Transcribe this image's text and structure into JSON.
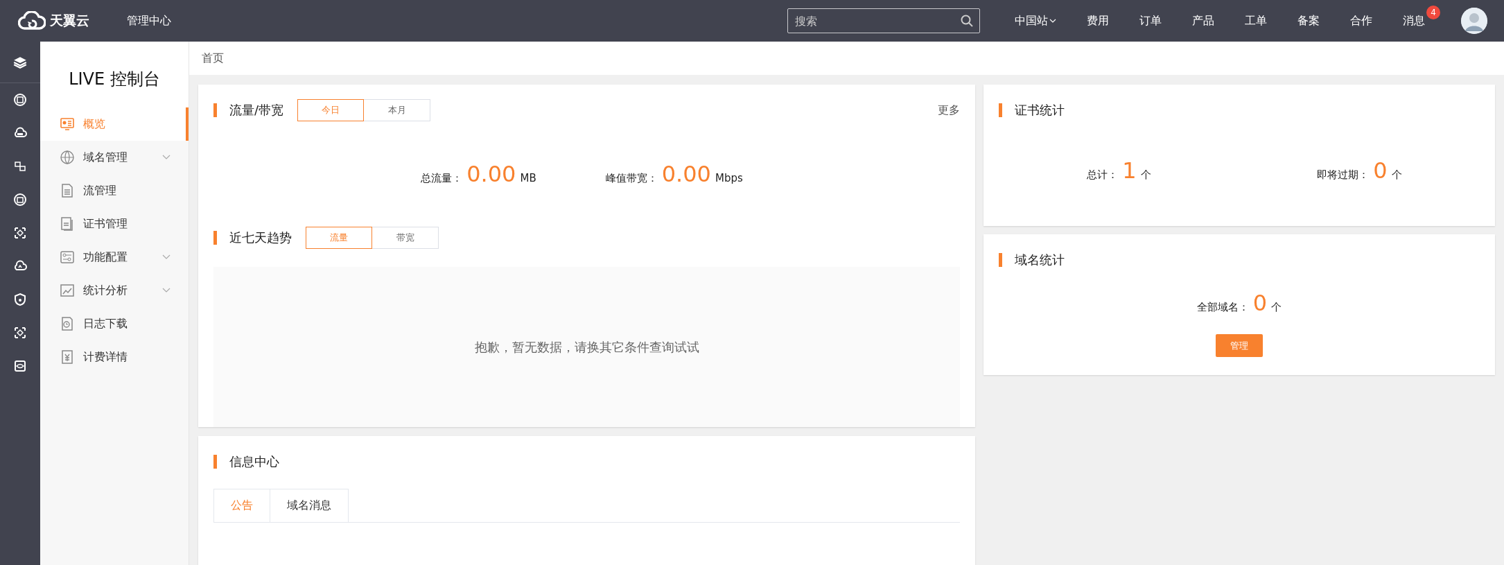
{
  "topbar": {
    "brand": "天翼云",
    "center": "管理中心",
    "search": {
      "placeholder": "搜索"
    },
    "nav": [
      {
        "label": "中国站",
        "dropdown": true
      },
      {
        "label": "费用",
        "dropdown": false
      },
      {
        "label": "订单",
        "dropdown": false
      },
      {
        "label": "产品",
        "dropdown": false
      },
      {
        "label": "工单",
        "dropdown": false
      },
      {
        "label": "备案",
        "dropdown": false
      },
      {
        "label": "合作",
        "dropdown": false
      },
      {
        "label": "消息",
        "dropdown": false,
        "badge": "4"
      }
    ]
  },
  "sidebar": {
    "title": "LIVE 控制台",
    "items": [
      {
        "label": "概览",
        "selected": true,
        "expandable": false
      },
      {
        "label": "域名管理",
        "selected": false,
        "expandable": true
      },
      {
        "label": "流管理",
        "selected": false,
        "expandable": false
      },
      {
        "label": "证书管理",
        "selected": false,
        "expandable": false
      },
      {
        "label": "功能配置",
        "selected": false,
        "expandable": true
      },
      {
        "label": "统计分析",
        "selected": false,
        "expandable": true
      },
      {
        "label": "日志下载",
        "selected": false,
        "expandable": false
      },
      {
        "label": "计费详情",
        "selected": false,
        "expandable": false
      }
    ]
  },
  "breadcrumb": "首页",
  "traffic": {
    "title": "流量/带宽",
    "more": "更多",
    "tabs": [
      {
        "label": "今日",
        "selected": true
      },
      {
        "label": "本月",
        "selected": false
      }
    ],
    "stats": [
      {
        "label": "总流量：",
        "value": "0.00",
        "unit": "MB"
      },
      {
        "label": "峰值带宽：",
        "value": "0.00",
        "unit": "Mbps"
      }
    ]
  },
  "trend": {
    "title": "近七天趋势",
    "tabs": [
      {
        "label": "流量",
        "selected": true
      },
      {
        "label": "带宽",
        "selected": false
      }
    ],
    "empty": "抱歉，暂无数据，请换其它条件查询试试"
  },
  "info": {
    "title": "信息中心",
    "tabs": [
      {
        "label": "公告",
        "selected": true
      },
      {
        "label": "域名消息",
        "selected": false
      }
    ]
  },
  "certs": {
    "title": "证书统计",
    "stats": [
      {
        "label": "总计：",
        "value": "1",
        "unit": "个"
      },
      {
        "label": "即将过期：",
        "value": "0",
        "unit": "个"
      }
    ]
  },
  "domains": {
    "title": "域名统计",
    "stats": [
      {
        "label": "全部域名：",
        "value": "0",
        "unit": "个"
      }
    ],
    "button": "管理"
  }
}
